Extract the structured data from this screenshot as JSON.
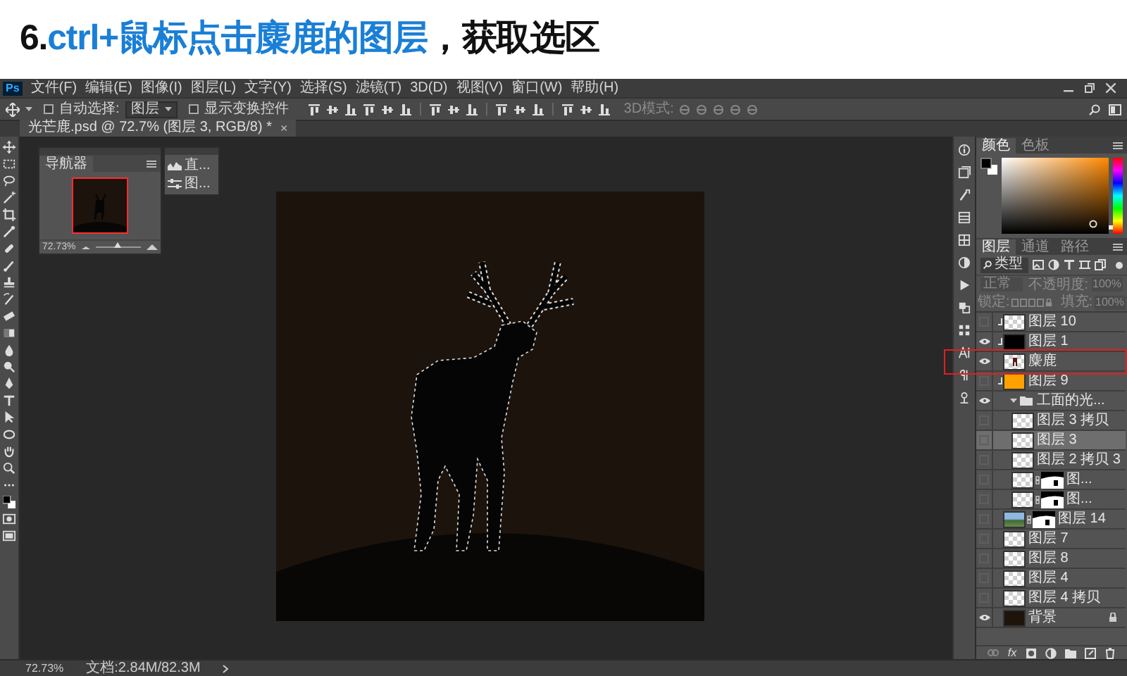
{
  "heading": [
    {
      "text": "6.",
      "highlight": false
    },
    {
      "text": "ctrl+鼠标点击麋鹿的图层",
      "highlight": true
    },
    {
      "text": "，获取选区",
      "highlight": false
    }
  ],
  "app": {
    "logo": "Ps"
  },
  "menu": [
    "文件(F)",
    "编辑(E)",
    "图像(I)",
    "图层(L)",
    "文字(Y)",
    "选择(S)",
    "滤镜(T)",
    "3D(D)",
    "视图(V)",
    "窗口(W)",
    "帮助(H)"
  ],
  "options_bar": {
    "auto_select": {
      "label": "自动选择:",
      "checked": false
    },
    "target": "图层",
    "show_transform": {
      "label": "显示变换控件",
      "checked": false
    },
    "mode_3d": "3D模式:"
  },
  "document_tab": {
    "title": "光芒鹿.psd @ 72.7% (图层 3, RGB/8) *",
    "close": "×"
  },
  "navigator": {
    "title": "导航器",
    "zoom": "72.73%",
    "zoom_slider": {
      "level": 0.5
    }
  },
  "color_panel_hue": {
    "level": 0.06
  },
  "mini_panel": {
    "items": [
      "直...",
      "图..."
    ]
  },
  "color_panel": {
    "tabs": [
      {
        "label": "颜色",
        "selected": true
      },
      {
        "label": "色板",
        "selected": false
      }
    ]
  },
  "layers_panel": {
    "tabs": [
      {
        "label": "图层",
        "selected": true
      },
      {
        "label": "通道",
        "selected": false
      },
      {
        "label": "路径",
        "selected": false
      }
    ],
    "filter": "类型",
    "blend_mode": "正常",
    "opacity_label": "不透明度:",
    "opacity": "100%",
    "lock_label": "锁定:",
    "fill_label": "填充:",
    "fill": "100%",
    "layers": [
      {
        "name": "图层 10",
        "visible": false,
        "clipped": true,
        "kind": "checker",
        "mask": false,
        "selected": false,
        "locked": false
      },
      {
        "name": "图层 1",
        "visible": true,
        "clipped": true,
        "kind": "black",
        "mask": false,
        "selected": false,
        "locked": false
      },
      {
        "name": "麋鹿",
        "visible": true,
        "clipped": false,
        "kind": "object",
        "mask": false,
        "selected": false,
        "locked": false
      },
      {
        "name": "图层 9",
        "visible": false,
        "clipped": true,
        "kind": "orange",
        "mask": false,
        "selected": false,
        "locked": false
      },
      {
        "name": "工面的光...",
        "kind": "group",
        "visible": true,
        "expanded": true,
        "selected": false,
        "children": [
          {
            "name": "图层 3 拷贝",
            "visible": false,
            "clipped": false,
            "kind": "checker",
            "mask": false,
            "selected": false,
            "locked": false
          },
          {
            "name": "图层 3",
            "visible": false,
            "clipped": false,
            "kind": "checker",
            "mask": false,
            "selected": true,
            "locked": false
          },
          {
            "name": "图层 2 拷贝 3",
            "visible": false,
            "clipped": false,
            "kind": "checker",
            "mask": false,
            "selected": false,
            "locked": false
          },
          {
            "name": "图...",
            "visible": false,
            "clipped": false,
            "kind": "checker",
            "mask": true,
            "selected": false,
            "locked": false
          },
          {
            "name": "图...",
            "visible": false,
            "clipped": false,
            "kind": "checker",
            "mask": true,
            "selected": false,
            "locked": false
          }
        ]
      },
      {
        "name": "图层 14",
        "visible": false,
        "clipped": false,
        "kind": "photo",
        "mask": true,
        "selected": false,
        "locked": false
      },
      {
        "name": "图层 7",
        "visible": false,
        "clipped": false,
        "kind": "checker",
        "mask": false,
        "selected": false,
        "locked": false
      },
      {
        "name": "图层 8",
        "visible": false,
        "clipped": false,
        "kind": "checker",
        "mask": false,
        "selected": false,
        "locked": false
      },
      {
        "name": "图层 4",
        "visible": false,
        "clipped": false,
        "kind": "checker",
        "mask": false,
        "selected": false,
        "locked": false
      },
      {
        "name": "图层 4 拷贝",
        "visible": false,
        "clipped": false,
        "kind": "checker",
        "mask": false,
        "selected": false,
        "locked": false
      },
      {
        "name": "背景",
        "visible": true,
        "clipped": false,
        "kind": "dark",
        "mask": false,
        "selected": false,
        "locked": true
      }
    ],
    "footer": {
      "fx": "fx"
    }
  },
  "status_bar": {
    "zoom": "72.73%",
    "doc_size": "文档:2.84M/82.3M"
  }
}
